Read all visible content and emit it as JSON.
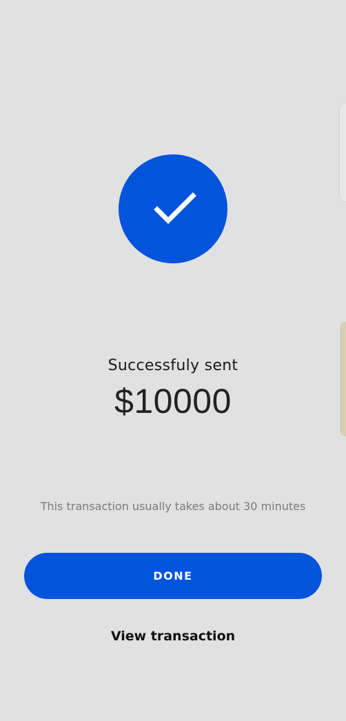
{
  "success": {
    "icon": "checkmark-icon",
    "title": "Successfuly sent",
    "amount": "$10000"
  },
  "note": "This transaction usually takes about 30 minutes",
  "actions": {
    "done_label": "DONE",
    "view_label": "View transaction"
  },
  "colors": {
    "background": "#e1e1e1",
    "accent": "#0254dc",
    "edge_handle": "#d9cfb5"
  }
}
